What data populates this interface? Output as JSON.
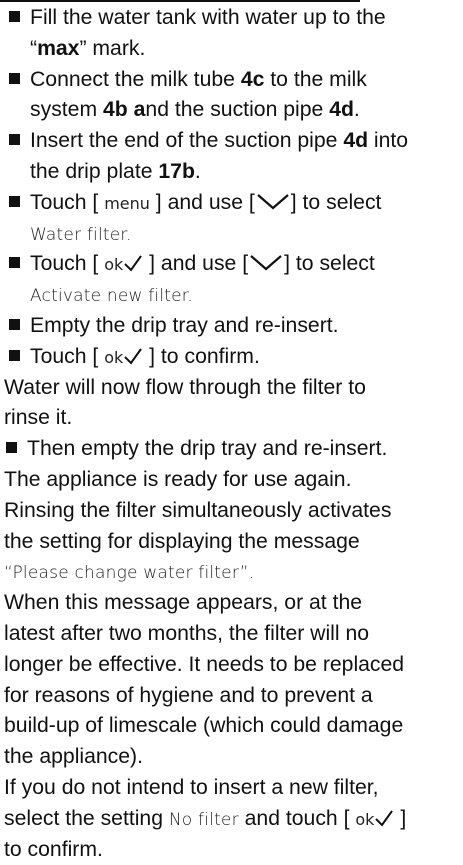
{
  "steps": [
    {
      "a": "Fill the water tank with water up to the",
      "b": "“",
      "max": "max",
      "c": "” mark."
    },
    {
      "a": "Connect the milk tube ",
      "ref1": "4c",
      "b": " to the milk",
      "c": "system ",
      "ref2": "4b",
      "d": " ",
      "ref2b": "a",
      "e": "nd the suction pipe ",
      "ref3": "4d",
      "f": "."
    },
    {
      "a": "Insert the end of the suction pipe ",
      "ref1": "4d",
      "b": " into",
      "c": "the drip plate ",
      "ref2": "17b",
      "d": "."
    },
    {
      "a": "Touch [ ",
      "key": "menu",
      "b": " ] and use [",
      "c": "] to select",
      "setting": "Water filter."
    },
    {
      "a": "Touch [ ",
      "key": "ok",
      "b": " ] and use [",
      "c": "] to select",
      "setting": "Activate new filter."
    },
    {
      "text": "Empty the drip tray and re-insert."
    },
    {
      "a": "Touch [ ",
      "key": "ok",
      "b": " ] to confirm."
    }
  ],
  "para1": [
    "Water will now flow through the filter to",
    "rinse it."
  ],
  "step_then": "Then empty the drip tray and re-insert.",
  "para2": "The appliance is ready for use again.",
  "para3": [
    "Rinsing the filter simultaneously activates",
    "the setting for displaying the message"
  ],
  "message": "“Please change water filter”.",
  "para4": [
    "When this message appears, or at the",
    "latest after two months, the filter will no",
    "longer be effective. It needs to be replaced",
    "for reasons of hygiene and to prevent a",
    "build-up of limescale (which could damage",
    "the appliance)."
  ],
  "para5": {
    "a": "If you do not intend to insert a new filter,",
    "b": "select the setting ",
    "setting": "No filter",
    "c": " and touch [ ",
    "key": "ok",
    "d": " ]",
    "e": "to confirm."
  },
  "icons": {
    "scroll": "chevron-down-icon",
    "confirm": "checkmark-icon"
  }
}
